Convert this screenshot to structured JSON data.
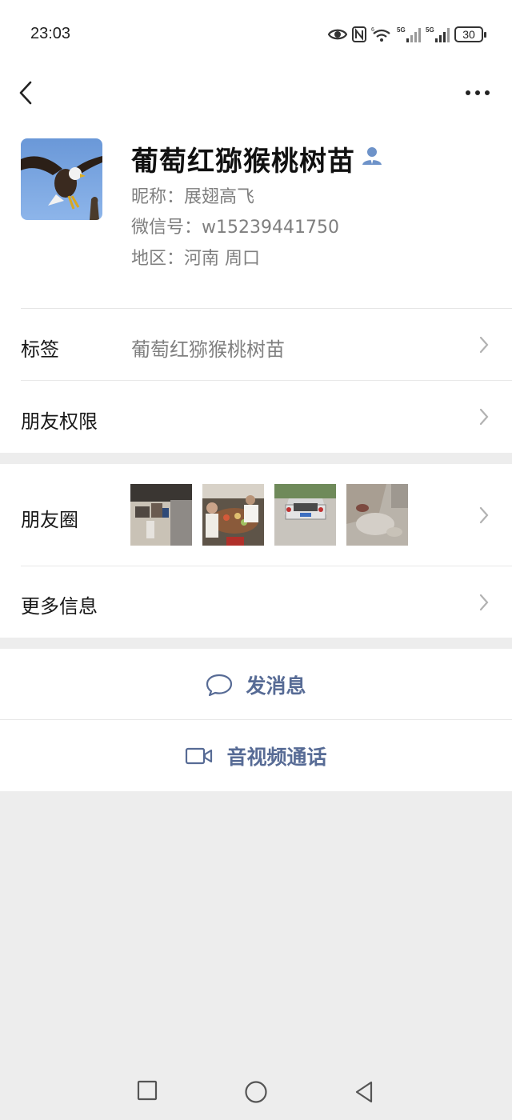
{
  "status_bar": {
    "time": "23:03",
    "battery": "30",
    "icons": [
      "eye-icon",
      "nfc-icon",
      "wifi-icon",
      "signal-5g-1-icon",
      "signal-5g-2-icon",
      "battery-icon"
    ]
  },
  "nav": {
    "back_icon": "chevron-left-icon",
    "more_icon": "more-dots-icon"
  },
  "profile": {
    "name": "葡萄红猕猴桃树苗",
    "nickname": "昵称：展翅高飞",
    "wechat_id": "微信号：w15239441750",
    "region": "地区：河南  周口"
  },
  "rows": {
    "tag": {
      "label": "标签",
      "value": "葡萄红猕猴桃树苗"
    },
    "permissions": {
      "label": "朋友权限"
    },
    "moments": {
      "label": "朋友圈"
    },
    "more_info": {
      "label": "更多信息"
    }
  },
  "actions": {
    "message": "发消息",
    "call": "音视频通话"
  },
  "colors": {
    "link": "#576b95",
    "background": "#ededed",
    "divider": "#e5e5e5"
  }
}
